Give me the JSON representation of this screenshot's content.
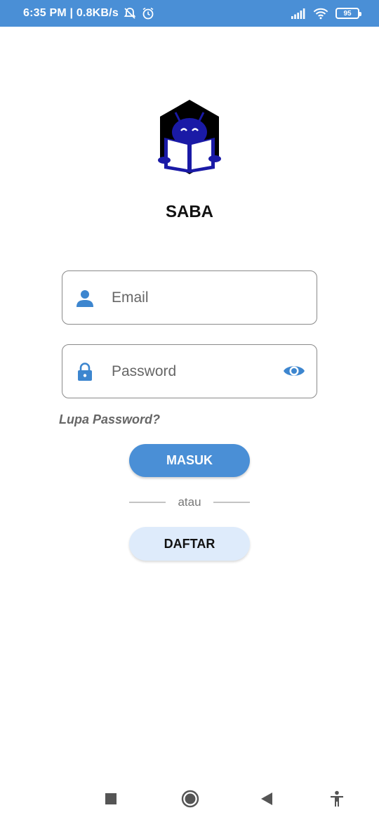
{
  "status_bar": {
    "time_speed": "6:35 PM | 0.8KB/s",
    "battery_level": "95",
    "icons": [
      "mute-alarm-icon",
      "alarm-clock-icon",
      "signal-icon",
      "wifi-icon",
      "battery-icon"
    ]
  },
  "app": {
    "title": "SABA",
    "logo": "saba-reading-robot-logo"
  },
  "login": {
    "email_placeholder": "Email",
    "email_value": "",
    "password_placeholder": "Password",
    "password_value": "",
    "forgot_label": "Lupa Password?",
    "login_button": "MASUK",
    "divider_text": "atau",
    "register_button": "DAFTAR"
  },
  "nav_bar": {
    "icons": [
      "recents-icon",
      "home-icon",
      "back-icon",
      "accessibility-icon"
    ]
  },
  "colors": {
    "primary": "#4a8fd6",
    "secondary_button": "#deebfb",
    "logo_blue": "#1a1aa6",
    "logo_dark": "#000000"
  }
}
